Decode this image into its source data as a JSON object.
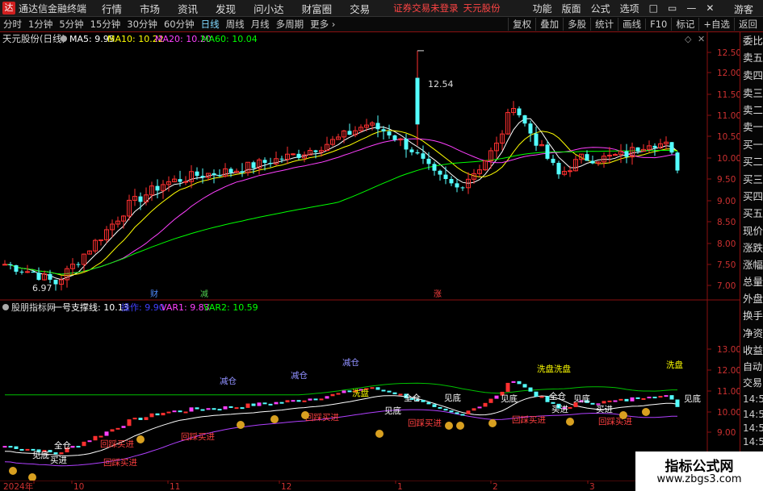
{
  "menubar": {
    "logo": "达",
    "app_title": "通达信金融终端",
    "items": [
      "行情",
      "市场",
      "资讯",
      "发现",
      "问小达",
      "财富圈",
      "交易"
    ],
    "warning": "证券交易未登录",
    "stock_name": "天元股份",
    "right_items": [
      "功能",
      "版面",
      "公式",
      "选项"
    ],
    "window_controls": [
      "□",
      "▭",
      "—",
      "✕"
    ],
    "guest": "游客"
  },
  "periodbar": {
    "periods": [
      "分时",
      "1分钟",
      "5分钟",
      "15分钟",
      "30分钟",
      "60分钟",
      "日线",
      "周线",
      "月线",
      "多周期",
      "更多 ›"
    ],
    "active": "日线",
    "tools": [
      "复权",
      "叠加",
      "多股",
      "统计",
      "画线",
      "F10",
      "标记",
      "+自选",
      "返回"
    ]
  },
  "main_chart": {
    "title": "天元股份(日线)",
    "ma_legend": [
      {
        "label": "MA5: 9.95",
        "color": "#ffffff"
      },
      {
        "label": "MA10: 10.22",
        "color": "#ffff00"
      },
      {
        "label": "MA20: 10.20",
        "color": "#ff40ff"
      },
      {
        "label": "MA60: 10.04",
        "color": "#00ff00"
      }
    ],
    "y_ticks": [
      "12.50",
      "12.00",
      "11.50",
      "11.00",
      "10.50",
      "10.00",
      "9.50",
      "9.00",
      "8.50",
      "8.00",
      "7.50",
      "7.00"
    ],
    "high_label": "12.54",
    "low_label": "6.97",
    "event_labels": [
      {
        "text": "财",
        "color": "#4f8cff"
      },
      {
        "text": "减",
        "color": "#4fcf4f"
      },
      {
        "text": "涨",
        "color": "#ff4040"
      }
    ]
  },
  "indicator_chart": {
    "title": "股朋指标网",
    "legend": [
      {
        "label": "一号支撑线: 10.13",
        "color": "#ffffff"
      },
      {
        "label": "操作: 9.90",
        "color": "#4040ff"
      },
      {
        "label": "VAR1: 9.83",
        "color": "#ff40ff"
      },
      {
        "label": "VAR2: 10.59",
        "color": "#00ff00"
      }
    ],
    "y_ticks": [
      "13.00",
      "12.00",
      "11.00",
      "10.00",
      "9.00",
      "8.00",
      "7.00"
    ],
    "signals": [
      {
        "text": "见底",
        "color": "#ffffff"
      },
      {
        "text": "买进",
        "color": "#ffffff"
      },
      {
        "text": "全仓",
        "color": "#ffffff"
      },
      {
        "text": "回踩买进",
        "color": "#ff4040"
      },
      {
        "text": "回踩买进",
        "color": "#ff4040"
      },
      {
        "text": "减仓",
        "color": "#9090ff"
      },
      {
        "text": "回踩买进",
        "color": "#ff4040"
      },
      {
        "text": "减仓",
        "color": "#9090ff"
      },
      {
        "text": "回踩买进",
        "color": "#ff4040"
      },
      {
        "text": "减仓",
        "color": "#9090ff"
      },
      {
        "text": "洗盘",
        "color": "#ffff00"
      },
      {
        "text": "见底",
        "color": "#ffffff"
      },
      {
        "text": "全仓",
        "color": "#ffffff"
      },
      {
        "text": "回踩买进",
        "color": "#ff4040"
      },
      {
        "text": "见底",
        "color": "#ffffff"
      },
      {
        "text": "见底",
        "color": "#ffffff"
      },
      {
        "text": "回踩买进",
        "color": "#ff4040"
      },
      {
        "text": "全仓",
        "color": "#ffffff"
      },
      {
        "text": "买进",
        "color": "#ffffff"
      },
      {
        "text": "洗盘洗盘",
        "color": "#ffff00"
      },
      {
        "text": "见底",
        "color": "#ffffff"
      },
      {
        "text": "买进",
        "color": "#ffffff"
      },
      {
        "text": "回踩买进",
        "color": "#ff4040"
      },
      {
        "text": "洗盘",
        "color": "#ffff00"
      },
      {
        "text": "见底",
        "color": "#ffffff"
      }
    ]
  },
  "x_axis": {
    "labels": [
      "2024年",
      "10",
      "11",
      "12",
      "1",
      "2",
      "3"
    ]
  },
  "right_panel": {
    "items": [
      "委比",
      "卖五",
      "卖四",
      "卖三",
      "卖二",
      "卖一",
      "买一",
      "买二",
      "买三",
      "买四",
      "买五",
      "现价",
      "涨跌",
      "涨幅",
      "总量",
      "外盘",
      "换手",
      "净资",
      "收益",
      "自动",
      "交易",
      "14:55",
      "14:55",
      "14:55",
      "14:56",
      "14:56",
      "14:56",
      "14:56"
    ]
  },
  "watermark": {
    "line1": "指标公式网",
    "line2": "www.zbgs3.com"
  },
  "colors": {
    "up": "#ff3030",
    "down": "#54ffff",
    "accent": "#8a1010"
  }
}
